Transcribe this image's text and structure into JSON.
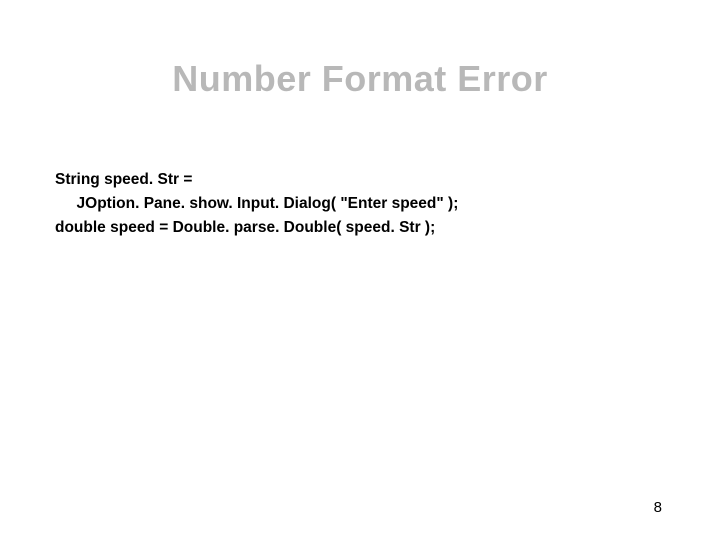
{
  "title": "Number Format Error",
  "code": {
    "line1": "String speed. Str =",
    "line2": "     JOption. Pane. show. Input. Dialog( \"Enter speed\" );",
    "line3": "double speed = Double. parse. Double( speed. Str );"
  },
  "page_number": "8"
}
